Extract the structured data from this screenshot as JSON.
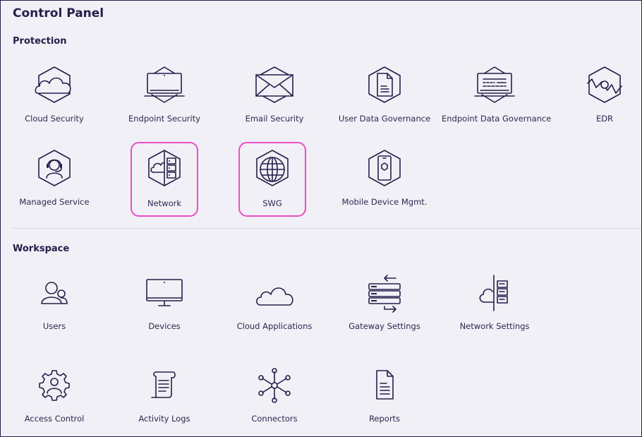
{
  "page": {
    "title": "Control Panel"
  },
  "protection": {
    "title": "Protection",
    "items": [
      {
        "label": "Cloud Security",
        "icon": "cloud-hex-icon"
      },
      {
        "label": "Endpoint Security",
        "icon": "laptop-hex-icon"
      },
      {
        "label": "Email Security",
        "icon": "envelope-hex-icon"
      },
      {
        "label": "User Data Governance",
        "icon": "document-hex-icon"
      },
      {
        "label": "Endpoint Data Governance",
        "icon": "laptop-document-hex-icon"
      },
      {
        "label": "EDR",
        "icon": "edr-hex-icon"
      },
      {
        "label": "Managed Service",
        "icon": "headset-hex-icon"
      },
      {
        "label": "Network",
        "icon": "network-hex-icon"
      },
      {
        "label": "SWG",
        "icon": "globe-hex-icon"
      },
      {
        "label": "Mobile Device Mgmt.",
        "icon": "mobile-hex-icon"
      }
    ]
  },
  "workspace": {
    "title": "Workspace",
    "items": [
      {
        "label": "Users",
        "icon": "users-icon"
      },
      {
        "label": "Devices",
        "icon": "monitor-icon"
      },
      {
        "label": "Cloud Applications",
        "icon": "cloud-icon"
      },
      {
        "label": "Gateway Settings",
        "icon": "gateway-icon"
      },
      {
        "label": "Network Settings",
        "icon": "cloud-server-icon"
      },
      {
        "label": "Access Control",
        "icon": "user-gear-icon"
      },
      {
        "label": "Activity Logs",
        "icon": "scroll-icon"
      },
      {
        "label": "Connectors",
        "icon": "hub-icon"
      },
      {
        "label": "Reports",
        "icon": "report-icon"
      }
    ]
  },
  "colors": {
    "text": "#23204a",
    "highlight": "#ea4fc6",
    "background": "#f1f0f6"
  }
}
